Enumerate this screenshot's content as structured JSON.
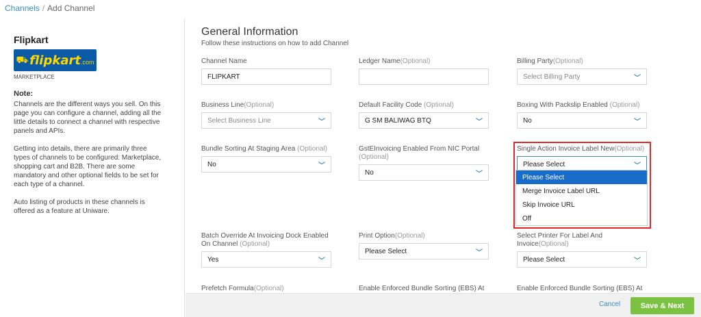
{
  "breadcrumb": {
    "parent": "Channels",
    "separator": "/",
    "current": "Add Channel"
  },
  "sidebar": {
    "channel_name": "Flipkart",
    "logo_text": "flipkart",
    "logo_suffix": ".com",
    "channel_type": "MARKETPLACE",
    "note_title": "Note:",
    "notes": [
      "Channels are the different ways you sell. On this page you can configure a channel, adding all the little details to connect a channel with respective panels and APIs.",
      "Getting into details, there are primarily three types of channels to be configured: Marketplace, shopping cart and B2B. There are some mandatory and other optional fields to be set for each type of a channel.",
      "Auto listing of products in these channels is offered as a feature at Uniware."
    ]
  },
  "main": {
    "title": "General Information",
    "subtitle": "Follow these instructions on how to add Channel"
  },
  "fields": {
    "channel_name": {
      "label": "Channel Name",
      "value": "FLIPKART"
    },
    "ledger_name": {
      "label": "Ledger Name",
      "optional": "(Optional)",
      "value": ""
    },
    "billing_party": {
      "label": "Billing Party",
      "optional": "(Optional)",
      "value": "Select Billing Party"
    },
    "business_line": {
      "label": "Business Line",
      "optional": "(Optional)",
      "value": "Select Business Line"
    },
    "default_facility": {
      "label": "Default Facility Code ",
      "optional": "(Optional)",
      "value": "G SM BALIWAG BTQ"
    },
    "boxing": {
      "label": "Boxing With Packslip Enabled ",
      "optional": "(Optional)",
      "value": "No"
    },
    "bundle_sorting": {
      "label": "Bundle Sorting At Staging Area ",
      "optional": "(Optional)",
      "value": "No"
    },
    "gst_einvoicing": {
      "label": "GstEInvoicing Enabled From NIC Portal ",
      "optional": "(Optional)",
      "value": "No"
    },
    "single_action": {
      "label": "Single Action Invoice Label New",
      "optional": "(Optional)",
      "value": "Please Select"
    },
    "batch_override": {
      "label": "Batch Override At Invoicing Dock Enabled On Channel ",
      "optional": "(Optional)",
      "value": "Yes"
    },
    "print_option": {
      "label": "Print Option",
      "optional": "(Optional)",
      "value": "Please Select"
    },
    "select_printer": {
      "label": "Select Printer For Label And Invoice",
      "optional": "(Optional)",
      "value": "Please Select"
    },
    "prefetch_formula": {
      "label": "Prefetch Formula",
      "optional": "(Optional)"
    },
    "ebs_1": {
      "label": "Enable Enforced Bundle Sorting (EBS) At"
    },
    "ebs_2": {
      "label": "Enable Enforced Bundle Sorting (EBS) At"
    }
  },
  "dropdown_options": [
    "Please Select",
    "Merge Invoice Label URL",
    "Skip Invoice URL",
    "Off"
  ],
  "footer": {
    "cancel": "Cancel",
    "save": "Save & Next"
  },
  "colors": {
    "accent": "#3c8dbc",
    "save_green": "#7cc242",
    "highlight_red": "#e0262b",
    "selected_blue": "#1a6ccb"
  }
}
